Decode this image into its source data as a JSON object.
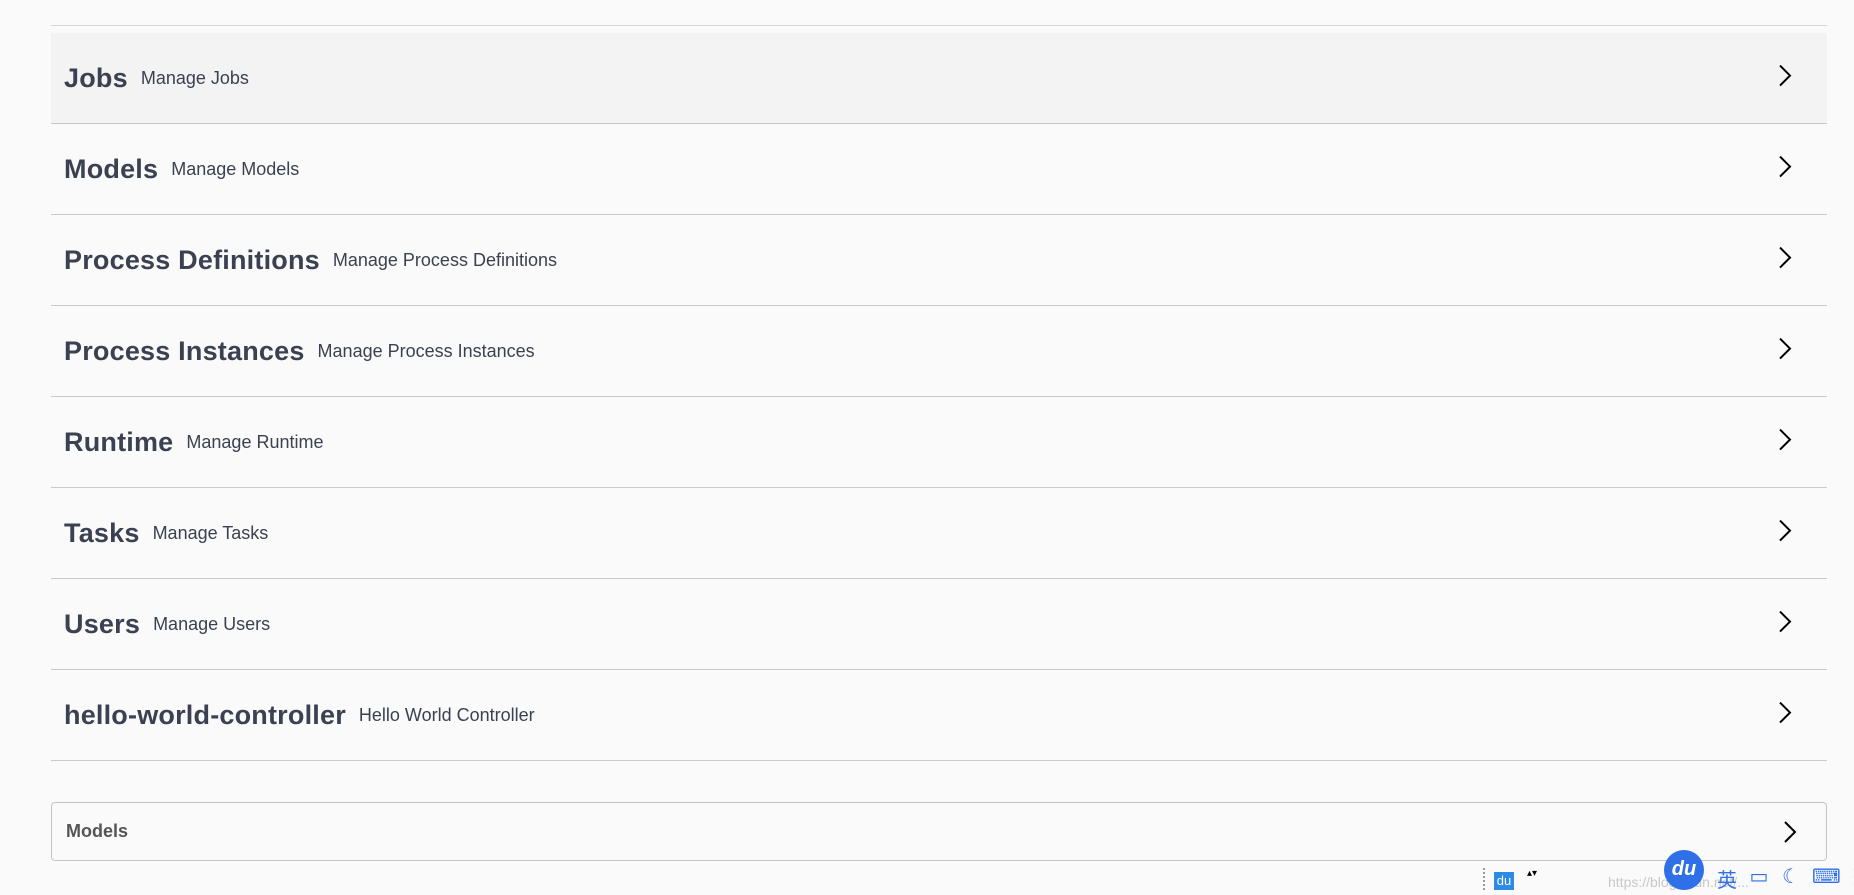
{
  "tags": [
    {
      "name": "Jobs",
      "description": "Manage Jobs"
    },
    {
      "name": "Models",
      "description": "Manage Models"
    },
    {
      "name": "Process Definitions",
      "description": "Manage Process Definitions"
    },
    {
      "name": "Process Instances",
      "description": "Manage Process Instances"
    },
    {
      "name": "Runtime",
      "description": "Manage Runtime"
    },
    {
      "name": "Tasks",
      "description": "Manage Tasks"
    },
    {
      "name": "Users",
      "description": "Manage Users"
    },
    {
      "name": "hello-world-controller",
      "description": "Hello World Controller"
    }
  ],
  "models_section": {
    "label": "Models"
  },
  "ime_toolbar": {
    "du_small": "du",
    "arrows": "▴▾",
    "watermark": "https://blog.csdn.net/...",
    "du_big": "du",
    "lang": "英",
    "icons": [
      "screen-icon",
      "moon-icon",
      "keyboard-icon",
      "more-icon"
    ]
  },
  "colors": {
    "text": "#3b4151",
    "divider": "#c9c9c9",
    "background": "#fafafa",
    "ime_blue": "#2f6fe8"
  }
}
